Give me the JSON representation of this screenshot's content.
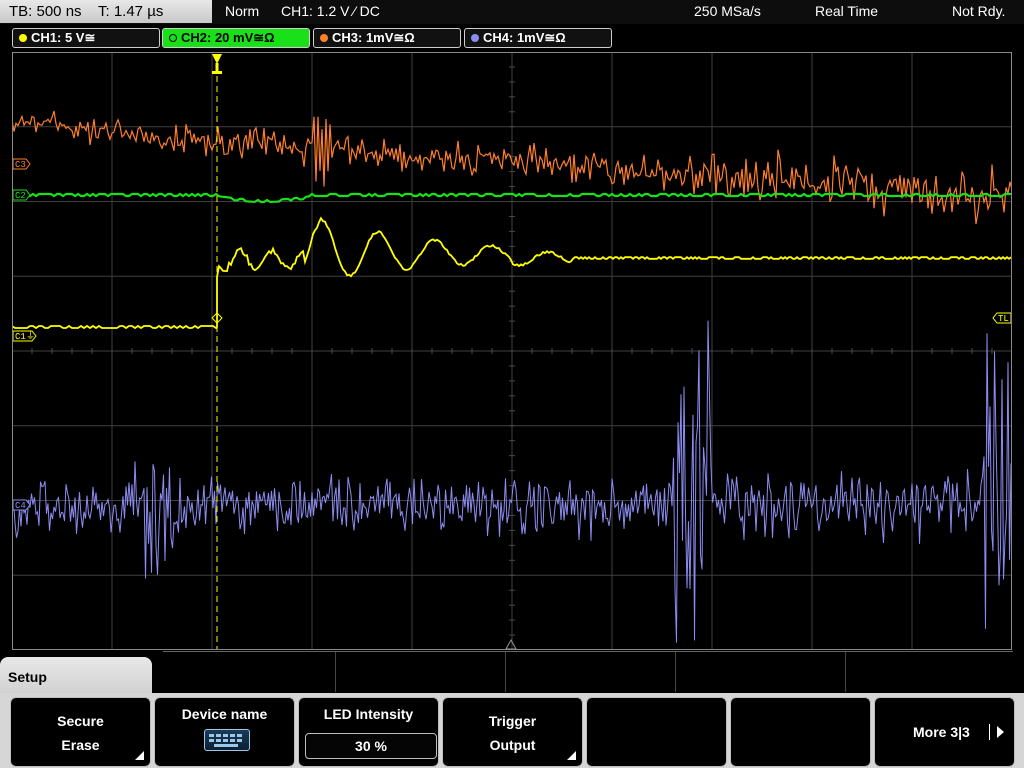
{
  "topbar": {
    "timebase": "TB: 500 ns",
    "trigger_time": "T: 1.47 µs",
    "trigger_mode": "Norm",
    "trigger_source": "CH1: 1.2 V ⁄ DC",
    "sample_rate": "250 MSa/s",
    "acq_mode": "Real Time",
    "status": "Not Rdy."
  },
  "channels": [
    {
      "label": "CH1: 5 V≅",
      "color": "#ffff00",
      "active": false
    },
    {
      "label": "CH2: 20 mV≅Ω",
      "color": "#19e019",
      "active": true
    },
    {
      "label": "CH3: 1mV≅Ω",
      "color": "#ff7f2a",
      "active": false
    },
    {
      "label": "CH4: 1mV≅Ω",
      "color": "#8c8cf0",
      "active": false
    }
  ],
  "screen_markers": {
    "ch3": "C3",
    "ch2": "C2",
    "ch1": "C1",
    "ch4": "C4",
    "trigger_level": "TL"
  },
  "menu": {
    "title": "Setup",
    "softkeys": [
      {
        "line1": "Secure",
        "line2": "Erase",
        "has_submenu": true
      },
      {
        "line1": "Device name",
        "icon": "keyboard-icon"
      },
      {
        "line1": "LED Intensity",
        "value": "30 %"
      },
      {
        "line1": "Trigger",
        "line2": "Output",
        "has_submenu": true
      },
      {
        "line1": ""
      },
      {
        "line1": ""
      },
      {
        "line1": "More 3|3"
      }
    ]
  }
}
